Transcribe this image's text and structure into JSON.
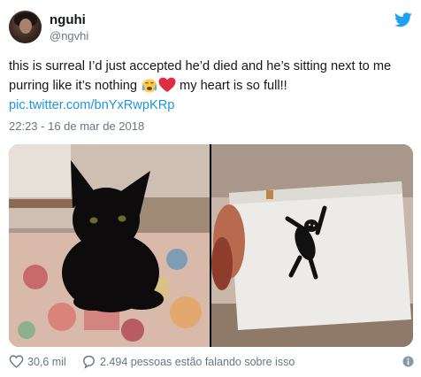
{
  "user": {
    "display_name": "nguhi",
    "handle": "@ngvhi"
  },
  "tweet": {
    "text_before_emoji": "this is surreal I’d just accepted he’d died and he’s sitting next to me purring like it’s nothing ",
    "emojis": [
      "crying-face-emoji",
      "red-heart-emoji"
    ],
    "text_after_emoji": " my heart is so full!!",
    "link": "pic.twitter.com/bnYxRwpKRp",
    "timestamp": "22:23 - 16 de mar de 2018"
  },
  "media": {
    "photos": [
      {
        "subject": "black cat sitting on a patchwork quilt"
      },
      {
        "subject": "hand holding a photo of a black cat"
      }
    ]
  },
  "footer": {
    "likes": "30,6 mil",
    "replies_text": "2.494 pessoas estão falando sobre isso"
  },
  "colors": {
    "link": "#1b95e0",
    "secondary_text": "#657786",
    "twitter_blue": "#1da1f2",
    "heart": "#e0245e"
  }
}
